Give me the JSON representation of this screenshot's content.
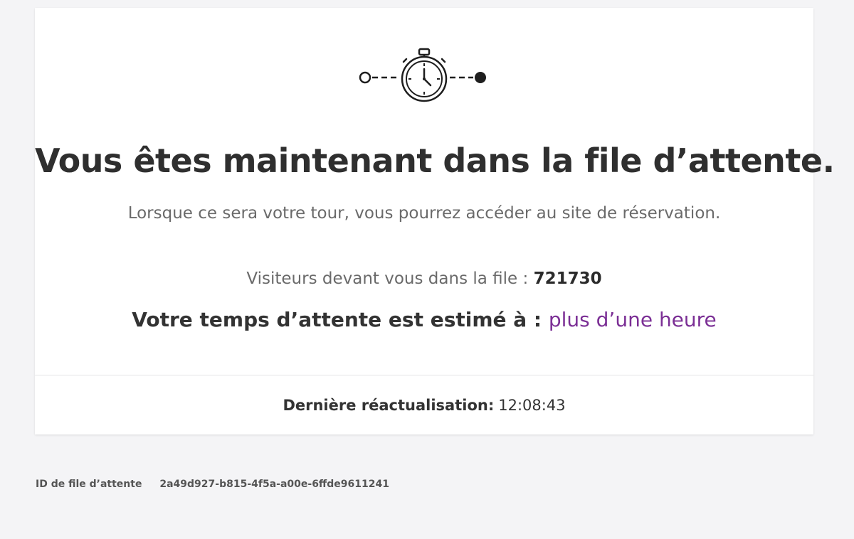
{
  "queue_page": {
    "title": "Vous êtes maintenant dans la file d’attente.",
    "subtitle": "Lorsque ce sera votre tour, vous pourrez accéder au site de réservation.",
    "visitors_label": "Visiteurs devant vous dans la file : ",
    "visitors_count": "721730",
    "wait_label": "Votre temps d’attente est estimé à : ",
    "wait_value": "plus d’une heure",
    "last_refresh_label": "Dernière réactualisation:",
    "last_refresh_time": "12:08:43",
    "queue_id_label": "ID de file d’attente",
    "queue_id_value": "2a49d927-b815-4f5a-a00e-6ffde9611241"
  },
  "icons": {
    "progress": "queue-progress-stopwatch-icon"
  },
  "colors": {
    "background": "#f4f4f6",
    "card": "#ffffff",
    "accent": "#7b2f95",
    "text": "#2f2f2f"
  }
}
